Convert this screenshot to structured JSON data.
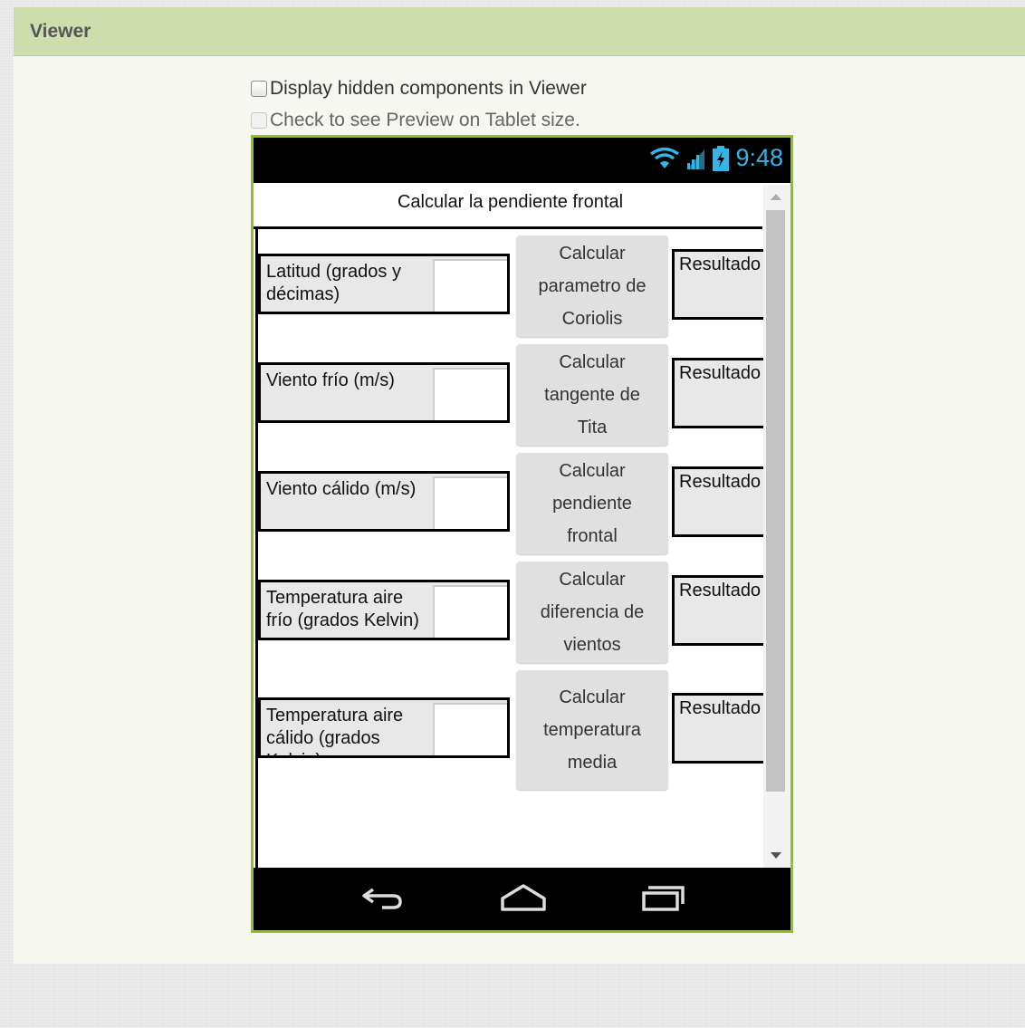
{
  "panel": {
    "title": "Viewer",
    "options": [
      {
        "label": "Display hidden components in Viewer",
        "checked": false,
        "enabled": true
      },
      {
        "label": "Check to see Preview on Tablet size.",
        "checked": false,
        "enabled": false
      }
    ]
  },
  "phone": {
    "status": {
      "time": "9:48",
      "icons": [
        "wifi-icon",
        "signal-icon",
        "battery-charging-icon"
      ]
    },
    "screen_title": "Calcular la pendiente frontal",
    "rows": [
      {
        "label": "Latitud (grados y décimas)",
        "input_value": "",
        "button": "Calcular\nparametro de\nCoriolis",
        "result": "Resultado"
      },
      {
        "label": "Viento frío (m/s)",
        "input_value": "",
        "button": "Calcular\ntangente de\nTita",
        "result": "Resultado"
      },
      {
        "label": "Viento cálido (m/s)",
        "input_value": "",
        "button": "Calcular\npendiente\nfrontal",
        "result": "Resultado"
      },
      {
        "label": "Temperatura aire frío (grados Kelvin)",
        "input_value": "",
        "button": "Calcular\ndiferencia de\nvientos",
        "result": "Resultado"
      },
      {
        "label": "Temperatura aire cálido (grados Kelvin)",
        "input_value": "",
        "button": "Calcular\ntemperatura\nmedia",
        "result": "Resultado"
      }
    ],
    "navbar": [
      "back-icon",
      "home-icon",
      "recent-apps-icon"
    ]
  },
  "colors": {
    "header": "#cdddab",
    "phone_border": "#8fc31e",
    "clock": "#33b5e5"
  }
}
